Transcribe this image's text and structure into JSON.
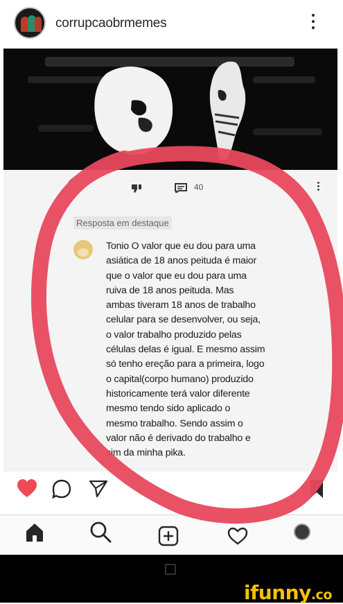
{
  "post": {
    "username": "corrupcaobrmemes"
  },
  "embedded_screenshot": {
    "comment_count": "40",
    "featured_tag": "Resposta em destaque",
    "comment_lines": [
      "Tonio O valor que eu dou para uma",
      "asiática de 18 anos peituda é maior",
      "que o valor que eu dou para uma",
      "ruiva de 18 anos peituda. Mas",
      "ambas tiveram 18 anos de trabalho",
      "celular para se desenvolver, ou seja,",
      "o valor trabalho produzido pelas",
      "células delas é igual. E mesmo assim",
      "só tenho ereção para a primeira, logo",
      "o capital(corpo humano) produzido",
      "historicamente terá valor diferente",
      "mesmo tendo sido aplicado o",
      "mesmo trabalho. Sendo assim o",
      "valor não é derivado do trabalho e",
      "sim da minha pika."
    ]
  },
  "icons": {
    "like": "heart-icon",
    "comment": "comment-icon",
    "share": "send-icon",
    "save": "bookmark-icon",
    "home": "home-icon",
    "search": "search-icon",
    "new_post": "add-post-icon",
    "activity": "activity-icon"
  },
  "colors": {
    "heart": "#ed4956",
    "circle": "#e8485d",
    "watermark": "#f2c200"
  },
  "watermark": {
    "brand": "ifunny",
    "suffix": ".co"
  }
}
